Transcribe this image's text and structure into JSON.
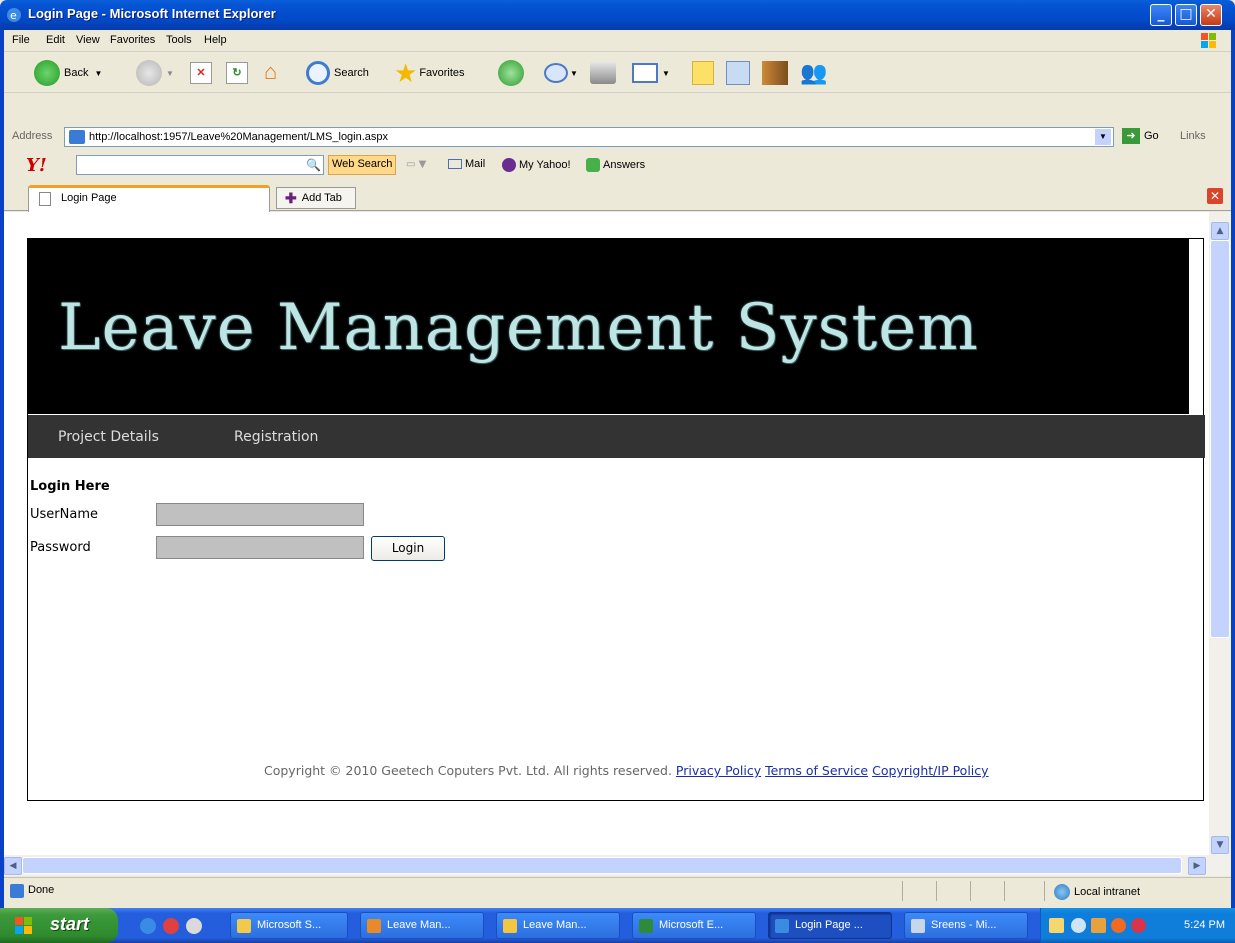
{
  "window": {
    "title": "Login Page - Microsoft Internet Explorer"
  },
  "menu": [
    "File",
    "Edit",
    "View",
    "Favorites",
    "Tools",
    "Help"
  ],
  "toolbar": {
    "back": "Back",
    "search": "Search",
    "favorites": "Favorites"
  },
  "address": {
    "label": "Address",
    "url": "http://localhost:1957/Leave%20Management/LMS_login.aspx",
    "go": "Go",
    "links": "Links"
  },
  "yahoo": {
    "search_button": "Web Search",
    "mail": "Mail",
    "my_yahoo": "My Yahoo!",
    "answers": "Answers"
  },
  "tabs": {
    "current": "Login Page",
    "add": "Add Tab"
  },
  "page": {
    "banner": "Leave Management System",
    "nav": [
      "Project Details",
      "Registration"
    ],
    "login": {
      "heading": "Login Here",
      "username_label": "UserName",
      "password_label": "Password",
      "button": "Login"
    },
    "footer": {
      "text": "Copyright © 2010 Geetech Coputers Pvt. Ltd. All rights reserved.",
      "links": [
        "Privacy Policy",
        "Terms of Service",
        "Copyright/IP Policy"
      ]
    }
  },
  "status": {
    "left": "Done",
    "zone": "Local intranet"
  },
  "taskbar": {
    "start": "start",
    "tasks": [
      "Microsoft S...",
      "Leave Man...",
      "Leave Man...",
      "Microsoft E...",
      "Login Page ...",
      "Sreens - Mi..."
    ],
    "clock": "5:24 PM"
  }
}
